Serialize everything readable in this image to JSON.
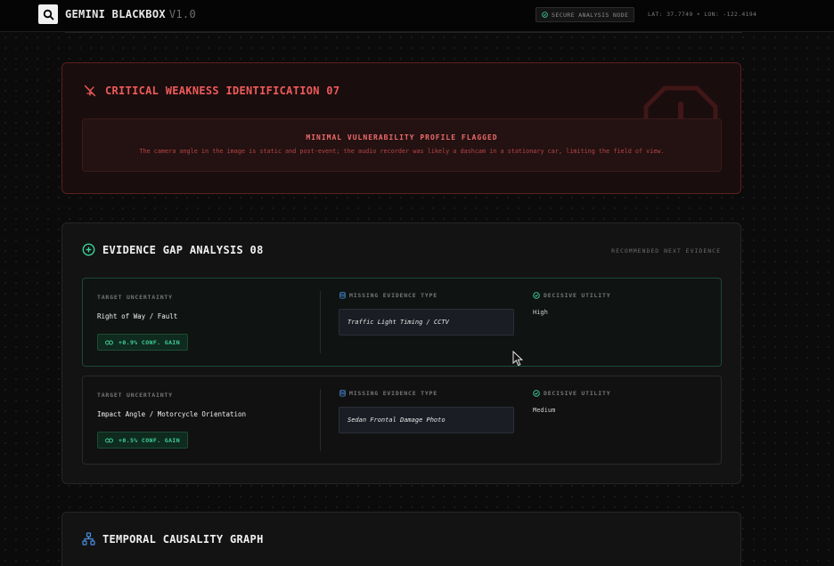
{
  "header": {
    "app_name": "GEMINI BLACKBOX",
    "version": "V1.0",
    "node_status": "SECURE ANALYSIS NODE",
    "coords": "LAT: 37.7749 • LON: -122.4194"
  },
  "critical": {
    "title": "CRITICAL WEAKNESS IDENTIFICATION 07",
    "heading": "MINIMAL VULNERABILITY PROFILE FLAGGED",
    "text": "The camera angle in the image is static and post-event; the audio recorder was likely a dashcam in a stationary car, limiting the field of view."
  },
  "gap": {
    "title": "EVIDENCE GAP ANALYSIS 08",
    "subtitle": "RECOMMENDED NEXT EVIDENCE",
    "labels": {
      "target": "TARGET UNCERTAINTY",
      "missing": "MISSING EVIDENCE TYPE",
      "utility": "DECISIVE UTILITY"
    },
    "items": [
      {
        "target": "Right of Way / Fault",
        "gain": "+0.9% CONF. GAIN",
        "evidence": "Traffic Light Timing / CCTV",
        "utility": "High"
      },
      {
        "target": "Impact Angle / Motorcycle Orientation",
        "gain": "+0.5% CONF. GAIN",
        "evidence": "Sedan Frontal Damage Photo",
        "utility": "Medium"
      }
    ]
  },
  "temporal": {
    "title": "TEMPORAL CAUSALITY GRAPH"
  },
  "colors": {
    "critical_red": "#ee5a5a",
    "success_green": "#3ed39a",
    "info_blue": "#4a8fe0"
  },
  "icons": {
    "logo": "search-icon",
    "critical": "crossed-out-icon",
    "warning": "octagon-warning-icon",
    "gap": "plus-circle-icon",
    "temporal": "hierarchy-icon"
  }
}
